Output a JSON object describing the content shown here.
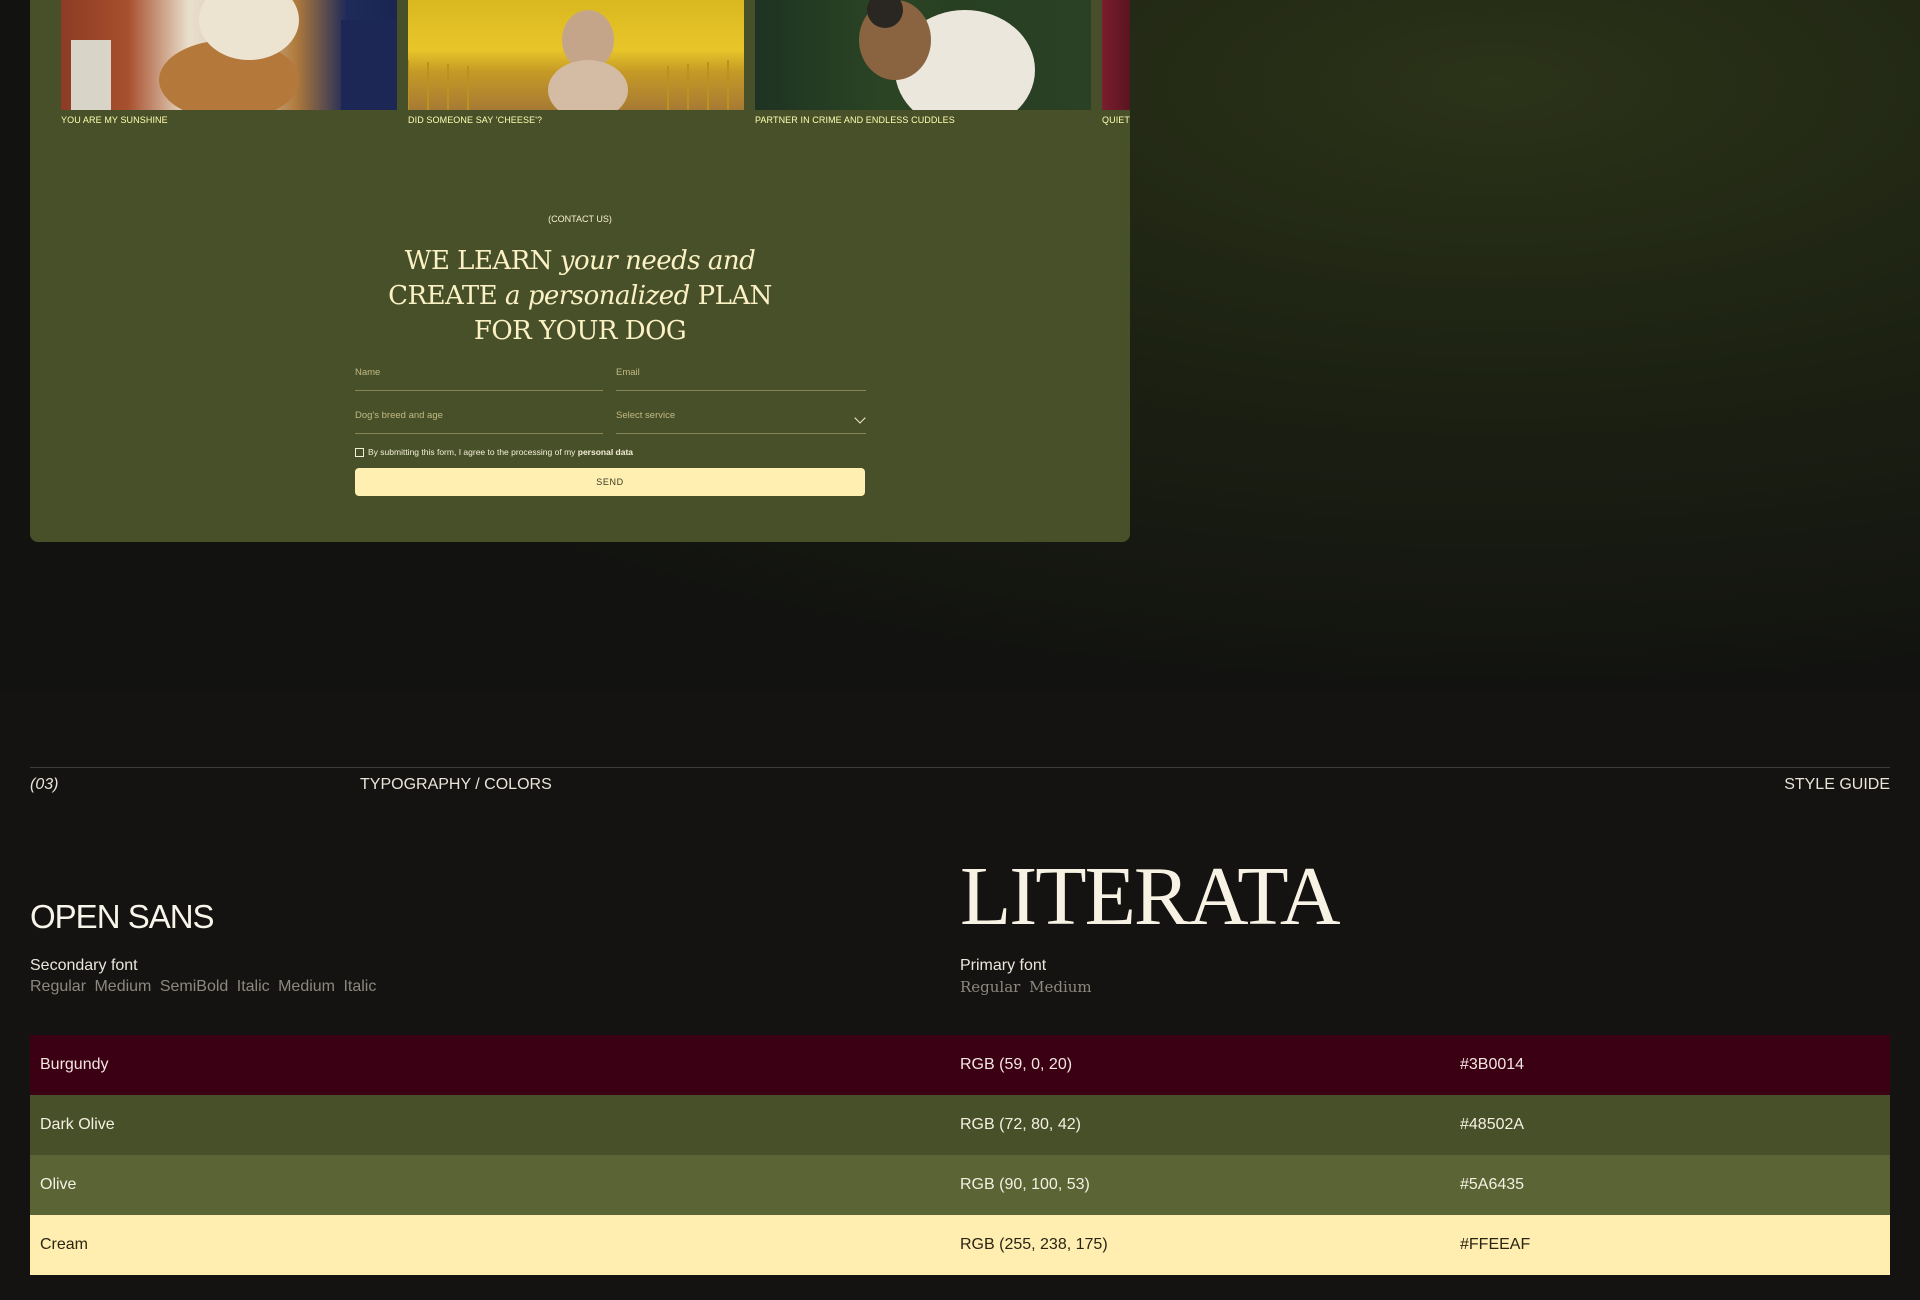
{
  "gallery": {
    "captions": [
      "YOU ARE MY SUNSHINE",
      "DID SOMEONE SAY 'CHEESE'?",
      "PARTNER IN CRIME AND ENDLESS CUDDLES",
      "QUIET"
    ]
  },
  "contact": {
    "eyebrow": "(CONTACT US)",
    "headline": {
      "line1_a": "WE LEARN ",
      "line1_b": "your needs and",
      "line2_a": "CREATE ",
      "line2_b": "a personalized",
      "line2_c": " PLAN",
      "line3": "FOR YOUR DOG"
    },
    "fields": {
      "name_placeholder": "Name",
      "email_placeholder": "Email",
      "breed_placeholder": "Dog's breed and age",
      "service_placeholder": "Select service"
    },
    "consent_text": "By submitting this form, I agree to the processing of my ",
    "consent_link": "personal data",
    "send_label": "SEND"
  },
  "style_guide": {
    "section_number": "(03)",
    "section_title": "TYPOGRAPHY / COLORS",
    "right_label": "STYLE GUIDE",
    "secondary_font": {
      "name": "OPEN SANS",
      "role": "Secondary font",
      "weights": "Regular  Medium  SemiBold  Italic  Medium Italic"
    },
    "primary_font": {
      "name": "LITERATA",
      "role": "Primary font",
      "weights": "Regular  Medium"
    },
    "colors": [
      {
        "name": "Burgundy",
        "rgb": "RGB (59, 0, 20)",
        "hex": "#3B0014"
      },
      {
        "name": "Dark Olive",
        "rgb": "RGB (72, 80, 42)",
        "hex": "#48502A"
      },
      {
        "name": "Olive",
        "rgb": "RGB (90, 100, 53)",
        "hex": "#5A6435"
      },
      {
        "name": "Cream",
        "rgb": "RGB (255, 238, 175)",
        "hex": "#FFEEAF"
      }
    ]
  }
}
